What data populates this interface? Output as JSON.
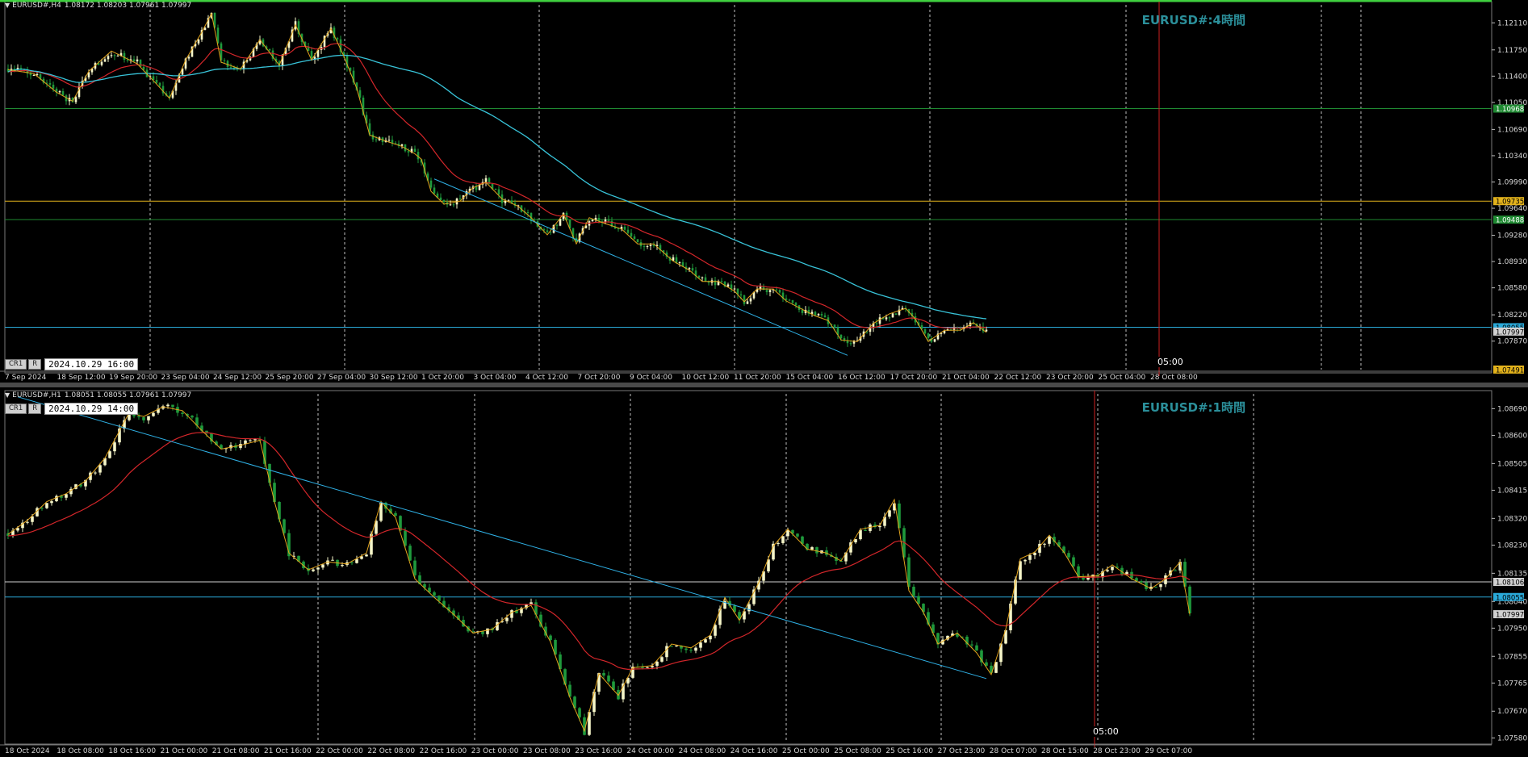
{
  "colors": {
    "background": "#000000",
    "bull_candle": "#f5f5c8",
    "bear_candle": "#1f9a3c",
    "ma_red": "#d3262a",
    "ma_cyan": "#38c3d8",
    "zigzag": "#e2a31c",
    "trendline": "#2fb1e6",
    "hline_green": "#1f8a32",
    "hline_yellow": "#e2b21c",
    "hline_blue": "#2aa9d8",
    "hline_white": "#d0d0d0",
    "vline_red": "#d02020",
    "watermark": "#2b8f9a"
  },
  "h4": {
    "header": {
      "symbol": "EURUSD#,H4",
      "ohlc": "1.08172 1.08203 1.07961 1.07997"
    },
    "buttons": [
      "CR1",
      "R"
    ],
    "date_box": "2024.10.29 16:00",
    "watermark": "EURUSD#:4時間",
    "vline_label": "05:00",
    "chart_data": {
      "type": "candlestick",
      "timeframe": "H4",
      "ylim": [
        1.0749,
        1.1235
      ],
      "price_ticks": [
        "1.12110",
        "1.11750",
        "1.11400",
        "1.11050",
        "1.10690",
        "1.10340",
        "1.09990",
        "1.09640",
        "1.09280",
        "1.08930",
        "1.08580",
        "1.08220",
        "1.07870"
      ],
      "price_labels": [
        {
          "text": "1.10968",
          "value": 1.10968,
          "bg": "#1f8a32",
          "fg": "#ffffff"
        },
        {
          "text": "1.09735",
          "value": 1.09735,
          "bg": "#e2b21c",
          "fg": "#000000"
        },
        {
          "text": "1.09488",
          "value": 1.09488,
          "bg": "#1f8a32",
          "fg": "#ffffff"
        },
        {
          "text": "1.08055",
          "value": 1.08055,
          "bg": "#2aa9d8",
          "fg": "#000000"
        },
        {
          "text": "1.07997",
          "value": 1.07997,
          "bg": "#d0d0d0",
          "fg": "#000000"
        },
        {
          "text": "1.07491",
          "value": 1.07491,
          "bg": "#e2b21c",
          "fg": "#000000"
        }
      ],
      "time_labels": [
        "7 Sep 2024",
        "18 Sep 12:00",
        "19 Sep 20:00",
        "23 Sep 04:00",
        "24 Sep 12:00",
        "25 Sep 20:00",
        "27 Sep 04:00",
        "30 Sep 12:00",
        "1 Oct 20:00",
        "3 Oct 04:00",
        "4 Oct 12:00",
        "7 Oct 20:00",
        "9 Oct 04:00",
        "10 Oct 12:00",
        "11 Oct 20:00",
        "15 Oct 04:00",
        "16 Oct 12:00",
        "17 Oct 20:00",
        "21 Oct 04:00",
        "22 Oct 12:00",
        "23 Oct 20:00",
        "25 Oct 04:00",
        "28 Oct 08:00"
      ],
      "hlines": [
        {
          "value": 1.10968,
          "color": "#1f8a32"
        },
        {
          "value": 1.09735,
          "color": "#e2b21c"
        },
        {
          "value": 1.09488,
          "color": "#1f8a32"
        },
        {
          "value": 1.08055,
          "color": "#2aa9d8"
        }
      ],
      "trendline": {
        "from": {
          "bar": 132,
          "price": 1.1003
        },
        "to": {
          "bar": 260,
          "price": 1.0768
        }
      },
      "close_path": [
        [
          0,
          1.115
        ],
        [
          8,
          1.1142
        ],
        [
          15,
          1.112
        ],
        [
          20,
          1.1105
        ],
        [
          25,
          1.1148
        ],
        [
          32,
          1.1172
        ],
        [
          40,
          1.1158
        ],
        [
          46,
          1.1128
        ],
        [
          50,
          1.1112
        ],
        [
          55,
          1.116
        ],
        [
          60,
          1.12
        ],
        [
          63,
          1.1222
        ],
        [
          66,
          1.116
        ],
        [
          72,
          1.1148
        ],
        [
          78,
          1.119
        ],
        [
          84,
          1.1153
        ],
        [
          89,
          1.121
        ],
        [
          94,
          1.116
        ],
        [
          100,
          1.1205
        ],
        [
          104,
          1.1165
        ],
        [
          108,
          1.1125
        ],
        [
          112,
          1.106
        ],
        [
          117,
          1.1055
        ],
        [
          122,
          1.1045
        ],
        [
          126,
          1.1038
        ],
        [
          128,
          1.1028
        ],
        [
          131,
          1.0988
        ],
        [
          135,
          1.0968
        ],
        [
          140,
          1.0975
        ],
        [
          144,
          1.099
        ],
        [
          148,
          1.1
        ],
        [
          153,
          1.0975
        ],
        [
          158,
          1.0968
        ],
        [
          162,
          1.095
        ],
        [
          167,
          1.093
        ],
        [
          172,
          1.0955
        ],
        [
          176,
          1.0918
        ],
        [
          180,
          1.095
        ],
        [
          185,
          1.0945
        ],
        [
          190,
          1.0935
        ],
        [
          195,
          1.0918
        ],
        [
          200,
          1.0915
        ],
        [
          206,
          1.0895
        ],
        [
          211,
          1.088
        ],
        [
          215,
          1.0868
        ],
        [
          220,
          1.0865
        ],
        [
          225,
          1.0855
        ],
        [
          228,
          1.0838
        ],
        [
          232,
          1.0858
        ],
        [
          237,
          1.0855
        ],
        [
          241,
          1.0842
        ],
        [
          245,
          1.083
        ],
        [
          250,
          1.0822
        ],
        [
          254,
          1.0813
        ],
        [
          258,
          1.079
        ],
        [
          263,
          1.0785
        ],
        [
          268,
          1.0812
        ],
        [
          273,
          1.0822
        ],
        [
          278,
          1.0832
        ],
        [
          281,
          1.0815
        ],
        [
          285,
          1.0788
        ],
        [
          290,
          1.08
        ],
        [
          295,
          1.0803
        ],
        [
          299,
          1.081
        ],
        [
          303,
          1.08
        ]
      ]
    }
  },
  "h1": {
    "header": {
      "symbol": "EURUSD#,H1",
      "ohlc": "1.08051 1.08055 1.07961 1.07997"
    },
    "buttons": [
      "CR1",
      "R"
    ],
    "date_box": "2024.10.29 14:00",
    "watermark": "EURUSD#:1時間",
    "vline_label": "05:00",
    "chart_data": {
      "type": "candlestick",
      "timeframe": "H1",
      "ylim": [
        1.0757,
        1.0874
      ],
      "price_ticks": [
        "1.08690",
        "1.08600",
        "1.08505",
        "1.08415",
        "1.08320",
        "1.08230",
        "1.08135",
        "1.08040",
        "1.07950",
        "1.07855",
        "1.07765",
        "1.07670",
        "1.07580"
      ],
      "price_labels": [
        {
          "text": "1.08106",
          "value": 1.08106,
          "bg": "#d0d0d0",
          "fg": "#000000"
        },
        {
          "text": "1.08055",
          "value": 1.08055,
          "bg": "#2aa9d8",
          "fg": "#000000"
        },
        {
          "text": "1.07997",
          "value": 1.07997,
          "bg": "#d0d0d0",
          "fg": "#000000"
        }
      ],
      "time_labels": [
        "18 Oct 2024",
        "18 Oct 08:00",
        "18 Oct 16:00",
        "21 Oct 00:00",
        "21 Oct 08:00",
        "21 Oct 16:00",
        "22 Oct 00:00",
        "22 Oct 08:00",
        "22 Oct 16:00",
        "23 Oct 00:00",
        "23 Oct 08:00",
        "23 Oct 16:00",
        "24 Oct 00:00",
        "24 Oct 08:00",
        "24 Oct 16:00",
        "25 Oct 00:00",
        "25 Oct 08:00",
        "25 Oct 16:00",
        "27 Oct 23:00",
        "28 Oct 07:00",
        "28 Oct 15:00",
        "28 Oct 23:00",
        "29 Oct 07:00"
      ],
      "hlines": [
        {
          "value": 1.08106,
          "color": "#d0d0d0"
        },
        {
          "value": 1.08055,
          "color": "#2aa9d8"
        }
      ],
      "trendline": {
        "from": {
          "bar": 2,
          "price": 1.0873
        },
        "to": {
          "bar": 202,
          "price": 1.0778
        }
      },
      "close_path": [
        [
          0,
          1.0827
        ],
        [
          4,
          1.0831
        ],
        [
          8,
          1.0838
        ],
        [
          12,
          1.084
        ],
        [
          16,
          1.0845
        ],
        [
          20,
          1.0852
        ],
        [
          25,
          1.0868
        ],
        [
          28,
          1.0866
        ],
        [
          32,
          1.087
        ],
        [
          36,
          1.0868
        ],
        [
          40,
          1.0862
        ],
        [
          44,
          1.0855
        ],
        [
          48,
          1.0857
        ],
        [
          52,
          1.0858
        ],
        [
          55,
          1.0838
        ],
        [
          58,
          1.082
        ],
        [
          62,
          1.0815
        ],
        [
          66,
          1.0817
        ],
        [
          70,
          1.0817
        ],
        [
          74,
          1.082
        ],
        [
          77,
          1.0838
        ],
        [
          80,
          1.0832
        ],
        [
          84,
          1.0812
        ],
        [
          88,
          1.0805
        ],
        [
          92,
          1.08
        ],
        [
          96,
          1.0793
        ],
        [
          100,
          1.0795
        ],
        [
          104,
          1.08
        ],
        [
          108,
          1.0803
        ],
        [
          112,
          1.079
        ],
        [
          116,
          1.0772
        ],
        [
          119,
          1.076
        ],
        [
          122,
          1.078
        ],
        [
          126,
          1.0772
        ],
        [
          129,
          1.0782
        ],
        [
          133,
          1.0782
        ],
        [
          137,
          1.079
        ],
        [
          141,
          1.0788
        ],
        [
          145,
          1.0793
        ],
        [
          148,
          1.0805
        ],
        [
          151,
          1.0798
        ],
        [
          155,
          1.081
        ],
        [
          158,
          1.0823
        ],
        [
          161,
          1.0828
        ],
        [
          165,
          1.0822
        ],
        [
          169,
          1.082
        ],
        [
          172,
          1.0818
        ],
        [
          176,
          1.0828
        ],
        [
          180,
          1.083
        ],
        [
          183,
          1.0838
        ],
        [
          186,
          1.0808
        ],
        [
          189,
          1.08
        ],
        [
          192,
          1.079
        ],
        [
          196,
          1.0793
        ],
        [
          200,
          1.0787
        ],
        [
          203,
          1.0779
        ],
        [
          206,
          1.0795
        ],
        [
          209,
          1.0818
        ],
        [
          212,
          1.0821
        ],
        [
          215,
          1.0826
        ],
        [
          218,
          1.0821
        ],
        [
          221,
          1.0812
        ],
        [
          225,
          1.0813
        ],
        [
          228,
          1.0816
        ],
        [
          232,
          1.0812
        ],
        [
          236,
          1.0808
        ],
        [
          239,
          1.0812
        ],
        [
          242,
          1.0817
        ],
        [
          244,
          1.08
        ]
      ]
    }
  }
}
